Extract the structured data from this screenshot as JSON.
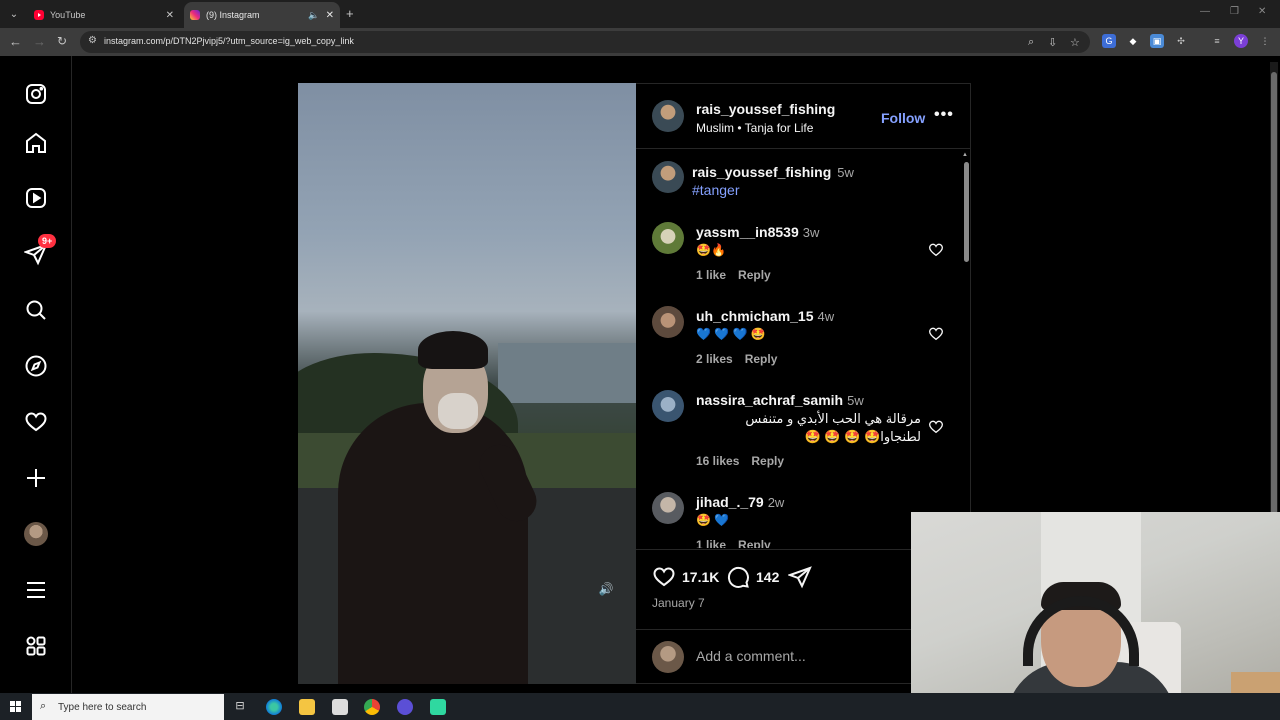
{
  "browser": {
    "tabs": [
      {
        "title": "YouTube",
        "favicon": "youtube-icon"
      },
      {
        "title": "(9) Instagram",
        "favicon": "instagram-icon",
        "active": true
      }
    ],
    "url": "instagram.com/p/DTN2Pjvipj5/?utm_source=ig_web_copy_link",
    "profile_initial": "Y"
  },
  "sidebar": {
    "items": [
      {
        "icon": "instagram-logo-icon"
      },
      {
        "icon": "home-icon"
      },
      {
        "icon": "reels-icon"
      },
      {
        "icon": "messages-icon",
        "badge": "9+"
      },
      {
        "icon": "search-icon"
      },
      {
        "icon": "explore-icon"
      },
      {
        "icon": "notifications-heart-icon"
      },
      {
        "icon": "create-plus-icon"
      },
      {
        "icon": "profile-avatar"
      },
      {
        "icon": "menu-icon"
      },
      {
        "icon": "more-apps-icon"
      }
    ]
  },
  "post": {
    "author": "rais_youssef_fishing",
    "subtitle_left": "Muslim",
    "subtitle_right": "Tanja for Life",
    "follow_label": "Follow",
    "caption_time": "5w",
    "caption": "#tanger",
    "likes": "17.1K",
    "comment_count": "142",
    "date": "January 7",
    "add_comment_placeholder": "Add a comment..."
  },
  "comments": [
    {
      "user": "yassm__in8539",
      "time": "3w",
      "text": "🤩🔥",
      "likes": "1 like",
      "reply": "Reply"
    },
    {
      "user": "uh_chmicham_15",
      "time": "4w",
      "text": "💙 💙 💙 🤩",
      "likes": "2 likes",
      "reply": "Reply"
    },
    {
      "user": "nassira_achraf_samih",
      "time": "5w",
      "text_line1": "مرقالة هي الحب الأبدي و متنفس",
      "text_line2": "لطنجاوا🤩 🤩 🤩 🤩",
      "likes": "16 likes",
      "reply": "Reply"
    },
    {
      "user": "jihad_._79",
      "time": "2w",
      "text": "🤩 💙",
      "likes": "1 like",
      "reply": "Reply"
    }
  ],
  "taskbar": {
    "search_placeholder": "Type here to search"
  },
  "colors": {
    "accent_link": "#85a1ff",
    "badge_red": "#ff3040",
    "background": "#000000"
  }
}
